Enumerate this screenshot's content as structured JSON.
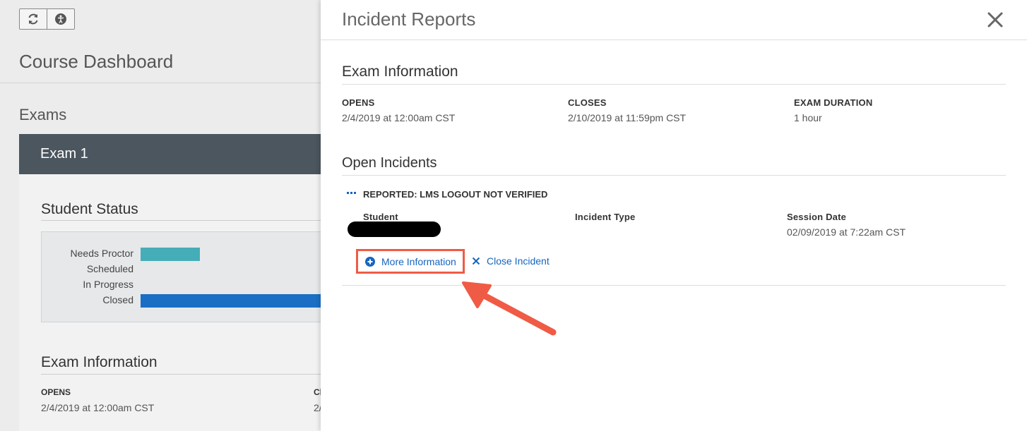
{
  "background": {
    "page_title": "Course Dashboard",
    "exams_heading": "Exams",
    "exam_card": {
      "title": "Exam 1",
      "student_status": {
        "title": "Student Status",
        "bars": [
          {
            "label": "Needs Proctor",
            "fraction": 0.33,
            "color": "#45adb7"
          },
          {
            "label": "Scheduled",
            "fraction": 0,
            "color": "#45adb7"
          },
          {
            "label": "In Progress",
            "fraction": 0,
            "color": "#45adb7"
          },
          {
            "label": "Closed",
            "fraction": 1.0,
            "color": "#1a6fc4"
          }
        ]
      },
      "exam_information": {
        "title": "Exam Information",
        "opens_label": "OPENS",
        "opens_value": "2/4/2019 at 12:00am CST",
        "closes_label_partial": "Cl",
        "closes_value_partial": "2/"
      }
    }
  },
  "panel": {
    "title": "Incident Reports",
    "close_icon": "close-icon",
    "exam_information": {
      "title": "Exam Information",
      "opens_label": "OPENS",
      "opens_value": "2/4/2019 at 12:00am CST",
      "closes_label": "CLOSES",
      "closes_value": "2/10/2019 at 11:59pm CST",
      "duration_label": "EXAM DURATION",
      "duration_value": "1 hour"
    },
    "open_incidents": {
      "title": "Open Incidents",
      "incident": {
        "heading": "REPORTED: LMS LOGOUT NOT VERIFIED",
        "student_label": "Student",
        "incident_type_label": "Incident Type",
        "session_date_label": "Session Date",
        "session_date_value": "02/09/2019 at 7:22am CST",
        "more_info_label": "More Information",
        "close_incident_label": "Close Incident"
      }
    },
    "accent_color": "#1565c0",
    "highlight_color": "#ef5b45"
  }
}
